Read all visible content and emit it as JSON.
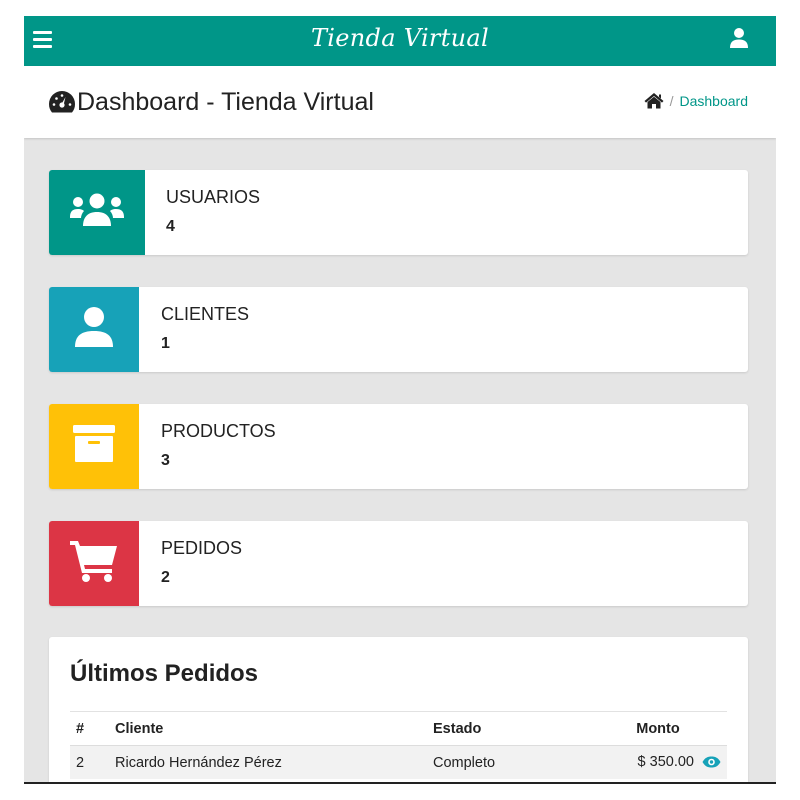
{
  "topbar": {
    "brand": "Tienda Virtual",
    "menu_icon": "hamburger-icon",
    "user_icon": "user-icon",
    "color": "#009688"
  },
  "header": {
    "title": "Dashboard - Tienda Virtual",
    "title_icon": "tachometer-icon",
    "breadcrumb": {
      "home_icon": "home-icon",
      "separator": "/",
      "current": "Dashboard"
    }
  },
  "stats": [
    {
      "label": "USUARIOS",
      "value": "4",
      "icon": "users-icon",
      "color": "#009688"
    },
    {
      "label": "CLIENTES",
      "value": "1",
      "icon": "user-icon",
      "color": "#17a2b8"
    },
    {
      "label": "PRODUCTOS",
      "value": "3",
      "icon": "archive-icon",
      "color": "#ffc107"
    },
    {
      "label": "PEDIDOS",
      "value": "2",
      "icon": "shopping-cart-icon",
      "color": "#dc3545"
    }
  ],
  "orders": {
    "title": "Últimos Pedidos",
    "columns": [
      "#",
      "Cliente",
      "Estado",
      "Monto"
    ],
    "rows": [
      {
        "num": "2",
        "cliente": "Ricardo Hernández Pérez",
        "estado": "Completo",
        "monto": "$ 350.00",
        "action_icon": "eye-icon"
      }
    ]
  }
}
